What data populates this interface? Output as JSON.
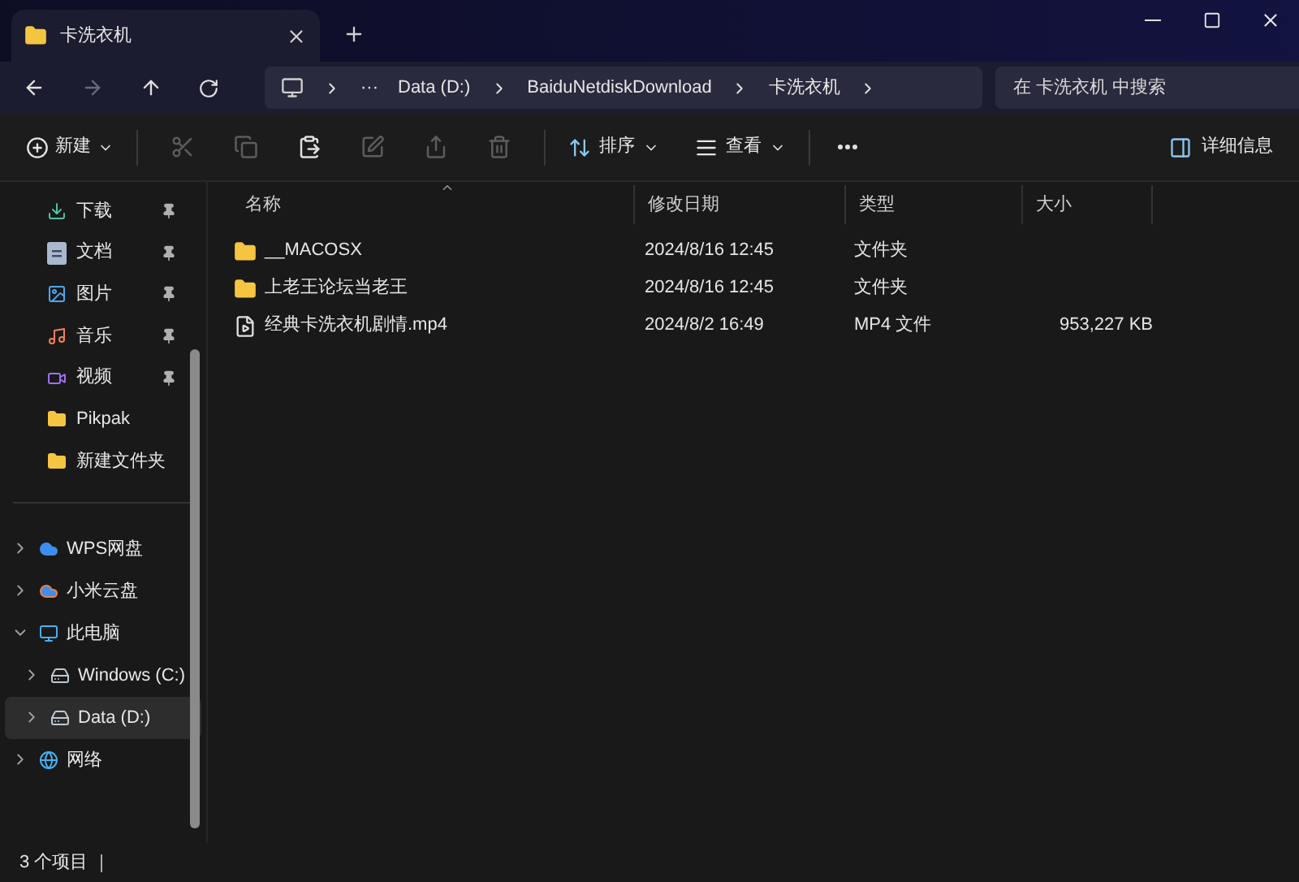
{
  "window": {
    "tab_title": "卡洗衣机"
  },
  "address_bar": {
    "overflow": "···",
    "crumbs": [
      "Data (D:)",
      "BaiduNetdiskDownload",
      "卡洗衣机"
    ]
  },
  "search": {
    "placeholder": "在 卡洗衣机 中搜索"
  },
  "toolbar": {
    "new_label": "新建",
    "icon_buttons": [
      {
        "kind": "cut",
        "disabled": true
      },
      {
        "kind": "copy",
        "disabled": true
      },
      {
        "kind": "paste",
        "disabled": false
      },
      {
        "kind": "rename",
        "disabled": true
      },
      {
        "kind": "share",
        "disabled": true
      },
      {
        "kind": "delete",
        "disabled": true
      }
    ],
    "sort_label": "排序",
    "view_label": "查看",
    "details_label": "详细信息"
  },
  "sidebar": {
    "pinned": [
      {
        "label": "下载",
        "kind": "download",
        "pinned": true
      },
      {
        "label": "文档",
        "kind": "documents",
        "pinned": true
      },
      {
        "label": "图片",
        "kind": "pictures",
        "pinned": true
      },
      {
        "label": "音乐",
        "kind": "music",
        "pinned": true
      },
      {
        "label": "视频",
        "kind": "videos",
        "pinned": true
      },
      {
        "label": "Pikpak",
        "kind": "folder",
        "pinned": false
      },
      {
        "label": "新建文件夹",
        "kind": "folder",
        "pinned": false
      }
    ],
    "tree": [
      {
        "label": "WPS网盘",
        "kind": "cloud",
        "expanded": false,
        "selected": false
      },
      {
        "label": "小米云盘",
        "kind": "cloud2",
        "expanded": false,
        "selected": false
      },
      {
        "label": "此电脑",
        "kind": "computer",
        "expanded": true,
        "selected": false,
        "children": [
          {
            "label": "Windows (C:)",
            "kind": "drive",
            "expanded": false,
            "selected": false
          },
          {
            "label": "Data (D:)",
            "kind": "drive",
            "expanded": false,
            "selected": true
          }
        ]
      },
      {
        "label": "网络",
        "kind": "network",
        "expanded": false,
        "selected": false
      }
    ]
  },
  "table": {
    "columns": [
      "名称",
      "修改日期",
      "类型",
      "大小"
    ],
    "rows": [
      {
        "kind": "folder",
        "name": "__MACOSX",
        "modified": "2024/8/16 12:45",
        "type": "文件夹"
      },
      {
        "kind": "folder",
        "name": "上老王论坛当老王",
        "modified": "2024/8/16 12:45",
        "type": "文件夹"
      },
      {
        "kind": "video",
        "name": "经典卡洗衣机剧情.mp4",
        "modified": "2024/8/2 16:49",
        "type": "MP4 文件",
        "size": "953,227 KB"
      }
    ]
  },
  "status_bar": {
    "count": "3 个项目"
  }
}
